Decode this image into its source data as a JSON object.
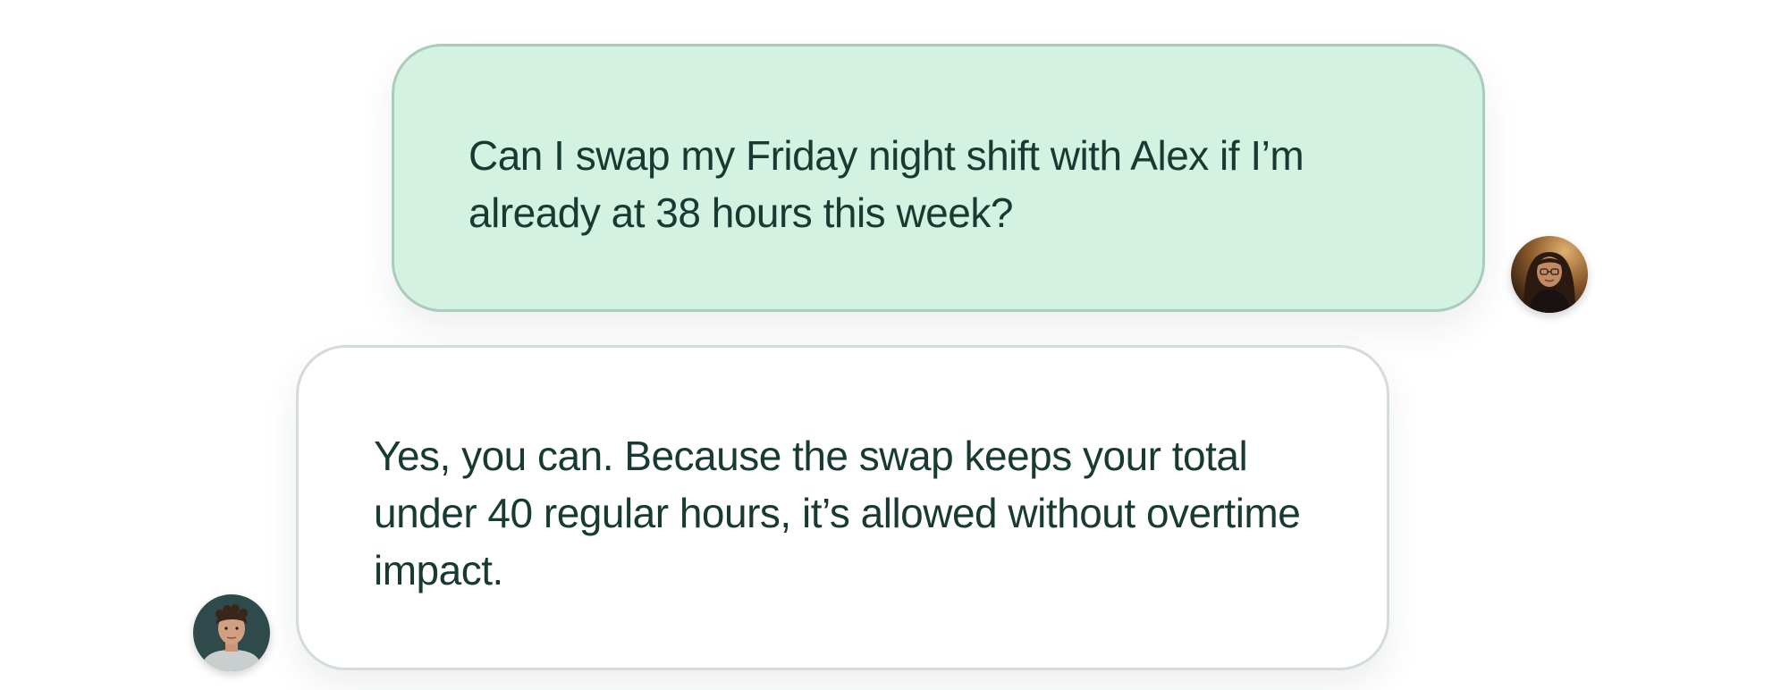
{
  "conversation": {
    "messages": [
      {
        "role": "user",
        "text": "Can I swap my Friday night shift with Alex if I’m already at 38 hours this week?",
        "avatar_icon": "user-avatar-icon"
      },
      {
        "role": "assistant",
        "text": "Yes, you can. Because the swap keeps your total under 40 regular hours, it’s allowed without overtime impact.",
        "avatar_icon": "assistant-avatar-icon"
      }
    ]
  },
  "colors": {
    "user_bubble_bg": "#d4f2e2",
    "user_bubble_border": "#a9ccbd",
    "assistant_bubble_bg": "#ffffff",
    "assistant_bubble_border": "#d4dcd9",
    "text": "#173a33"
  }
}
